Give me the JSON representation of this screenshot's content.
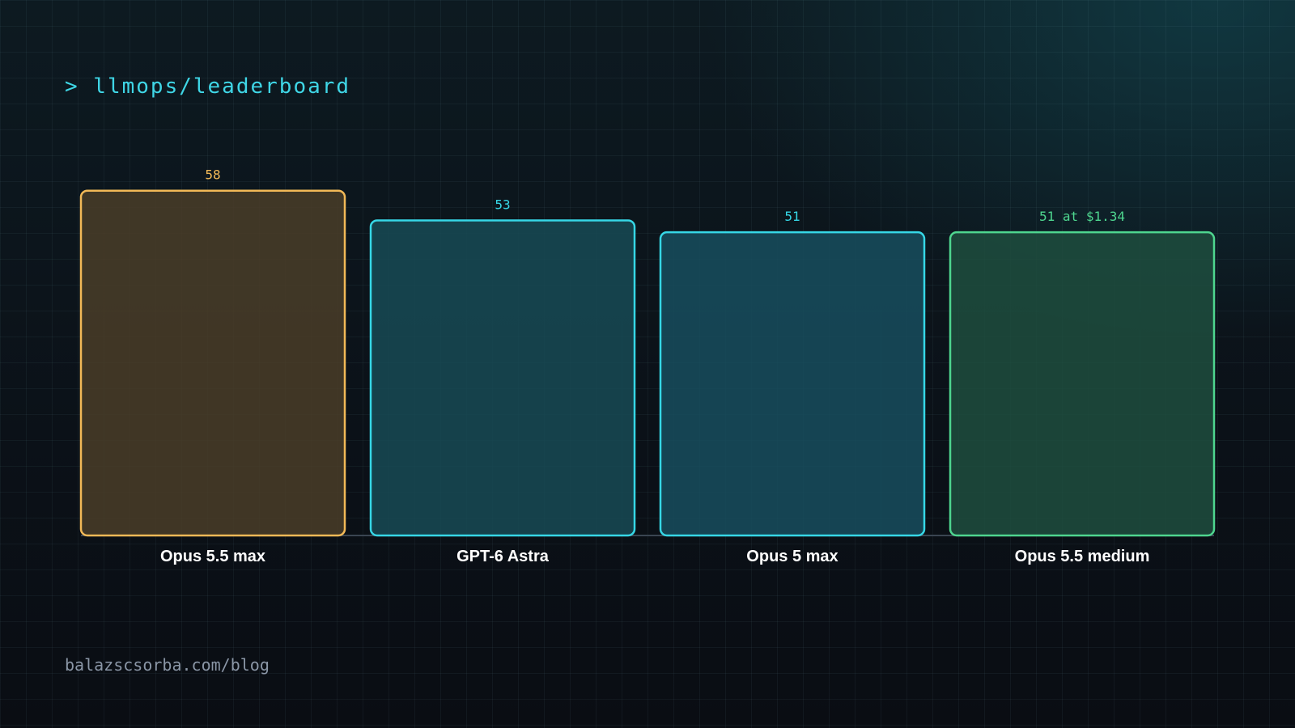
{
  "header": {
    "prompt": "> llmops/leaderboard"
  },
  "footer": {
    "url": "balazscsorba.com/blog"
  },
  "chart_data": {
    "type": "bar",
    "categories": [
      "Opus 5.5 max",
      "GPT-6 Astra",
      "Opus 5 max",
      "Opus 5.5 medium"
    ],
    "values": [
      58,
      53,
      51,
      51
    ],
    "data_labels": [
      "58",
      "53",
      "51",
      "51 at $1.34"
    ],
    "colors": [
      "#f2b957",
      "#36d7e6",
      "#36d7e6",
      "#4ed68f"
    ],
    "fills": [
      "#4a3d28",
      "#174a55",
      "#174e5e",
      "#1e4d3e"
    ],
    "title": "",
    "xlabel": "",
    "ylabel": "",
    "grid": true,
    "legend": "none"
  }
}
